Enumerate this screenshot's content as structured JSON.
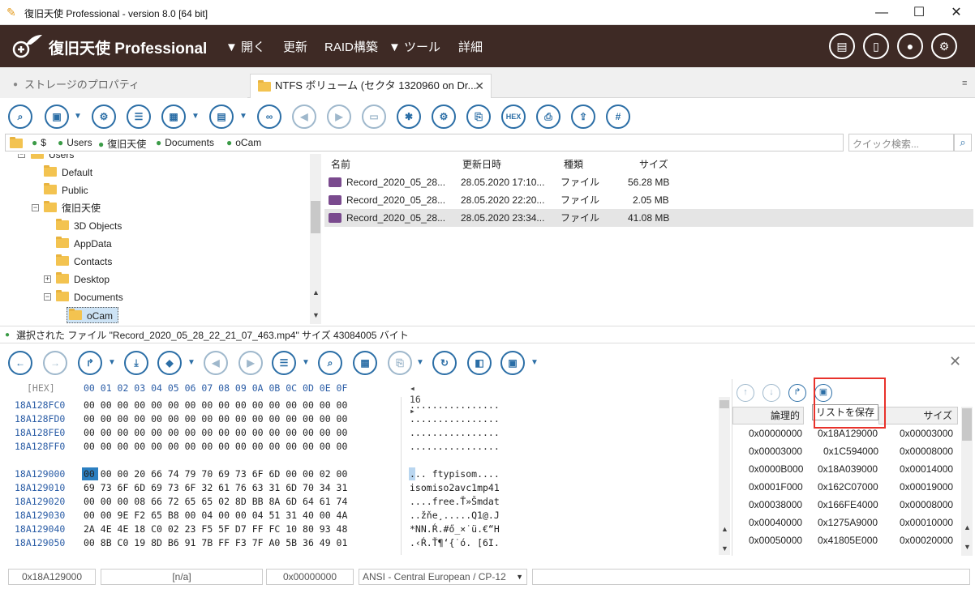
{
  "window": {
    "title": "復旧天使 Professional - version 8.0 [64 bit]"
  },
  "app": {
    "brand": "復旧天使 Professional",
    "menu": [
      "▼ 開く",
      "更新",
      "RAID構築",
      "▼ ツール",
      "詳細"
    ]
  },
  "tabs": [
    {
      "label": "ストレージのプロパティ"
    },
    {
      "label": "NTFS ボリューム (セクタ 1320960 on Dr..."
    }
  ],
  "toolbar1": {
    "hex_label": "HEX"
  },
  "breadcrumb": [
    "$",
    "Users",
    "復旧天使",
    "Documents",
    "oCam"
  ],
  "search": {
    "placeholder": "クイック検索..."
  },
  "tree": [
    {
      "label": "Users",
      "depth": 0
    },
    {
      "label": "Default",
      "depth": 1
    },
    {
      "label": "Public",
      "depth": 1
    },
    {
      "label": "復旧天使",
      "depth": 1
    },
    {
      "label": "3D Objects",
      "depth": 2
    },
    {
      "label": "AppData",
      "depth": 2
    },
    {
      "label": "Contacts",
      "depth": 2
    },
    {
      "label": "Desktop",
      "depth": 2
    },
    {
      "label": "Documents",
      "depth": 2
    },
    {
      "label": "oCam",
      "depth": 3
    }
  ],
  "list": {
    "headers": [
      "名前",
      "更新日時",
      "種類",
      "サイズ"
    ],
    "rows": [
      {
        "name": "Record_2020_05_28...",
        "date": "28.05.2020 17:10...",
        "type": "ファイル",
        "size": "56.28 MB"
      },
      {
        "name": "Record_2020_05_28...",
        "date": "28.05.2020 22:20...",
        "type": "ファイル",
        "size": "2.05 MB"
      },
      {
        "name": "Record_2020_05_28...",
        "date": "28.05.2020 23:34...",
        "type": "ファイル",
        "size": "41.08 MB"
      }
    ]
  },
  "selected": {
    "text": "選択された ファイル \"Record_2020_05_28_22_21_07_463.mp4\" サイズ 43084005 バイト"
  },
  "hex": {
    "label": "[HEX]",
    "columns": "00 01 02 03 04 05 06 07 08 09 0A 0B 0C 0D 0E 0F",
    "width_label": "◂ 16 ▸",
    "rows": [
      {
        "off": "18A128FC0",
        "bytes": "00 00 00 00 00 00 00 00 00 00 00 00 00 00 00 00",
        "ascii": "................"
      },
      {
        "off": "18A128FD0",
        "bytes": "00 00 00 00 00 00 00 00 00 00 00 00 00 00 00 00",
        "ascii": "................"
      },
      {
        "off": "18A128FE0",
        "bytes": "00 00 00 00 00 00 00 00 00 00 00 00 00 00 00 00",
        "ascii": "................"
      },
      {
        "off": "18A128FF0",
        "bytes": "00 00 00 00 00 00 00 00 00 00 00 00 00 00 00 00",
        "ascii": "................"
      },
      {
        "off": "18A129000",
        "bytes": "00 00 00 20 66 74 79 70 69 73 6F 6D 00 00 02 00",
        "ascii": "... ftypisom...."
      },
      {
        "off": "18A129010",
        "bytes": "69 73 6F 6D 69 73 6F 32 61 76 63 31 6D 70 34 31",
        "ascii": "isomiso2avc1mp41"
      },
      {
        "off": "18A129020",
        "bytes": "00 00 00 08 66 72 65 65 02 8D BB 8A 6D 64 61 74",
        "ascii": "....free.Ť»Šmdat"
      },
      {
        "off": "18A129030",
        "bytes": "00 00 9E F2 65 B8 00 04 00 00 04 51 31 40 00 4A",
        "ascii": "..žňe¸.....Q1@.J"
      },
      {
        "off": "18A129040",
        "bytes": "2A 4E 4E 18 C0 02 23 F5 5F D7 FF FC 10 80 93 48",
        "ascii": "*NN.Ŕ.#ő_×˙ü.€“H"
      },
      {
        "off": "18A129050",
        "bytes": "00 8B C0 19 8D B6 91 7B FF F3 7F A0 5B 36 49 01",
        "ascii": ".‹Ŕ.Ť¶‘{˙ó. [6I."
      }
    ]
  },
  "right": {
    "headers": [
      "論理的",
      "",
      "サイズ"
    ],
    "tooltip": "リストを保存",
    "rows": [
      {
        "a": "0x00000000",
        "b": "0x18A129000",
        "c": "0x00003000"
      },
      {
        "a": "0x00003000",
        "b": "0x1C594000",
        "c": "0x00008000"
      },
      {
        "a": "0x0000B000",
        "b": "0x18A039000",
        "c": "0x00014000"
      },
      {
        "a": "0x0001F000",
        "b": "0x162C07000",
        "c": "0x00019000"
      },
      {
        "a": "0x00038000",
        "b": "0x166FE4000",
        "c": "0x00008000"
      },
      {
        "a": "0x00040000",
        "b": "0x1275A9000",
        "c": "0x00010000"
      },
      {
        "a": "0x00050000",
        "b": "0x41805E000",
        "c": "0x00020000"
      }
    ]
  },
  "status": {
    "offset": "0x18A129000",
    "na": "[n/a]",
    "value": "0x00000000",
    "encoding": "ANSI - Central European / CP-12"
  },
  "colors": {
    "appbar": "#3e2a25",
    "accent": "#2b6ea6",
    "highlight": "#e8322b"
  }
}
